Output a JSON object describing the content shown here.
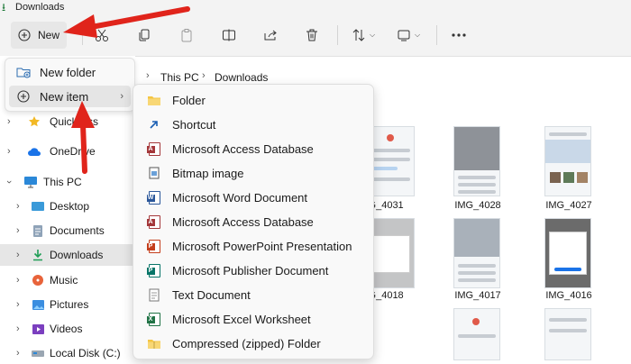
{
  "window": {
    "title": "Downloads"
  },
  "toolbar": {
    "new_label": "New",
    "icons": [
      "plus-circle-icon",
      "cut-icon",
      "copy-icon",
      "paste-icon",
      "rename-icon",
      "share-icon",
      "delete-icon",
      "sort-icon",
      "view-icon",
      "more-icon"
    ]
  },
  "address": {
    "segments": [
      "This PC",
      "Downloads"
    ]
  },
  "flyout": {
    "items": [
      {
        "label": "New folder",
        "icon": "new-folder-icon"
      },
      {
        "label": "New item",
        "icon": "plus-circle-icon",
        "has_submenu": true
      }
    ]
  },
  "submenu": {
    "items": [
      {
        "label": "Folder",
        "icon": "folder-icon"
      },
      {
        "label": "Shortcut",
        "icon": "shortcut-icon"
      },
      {
        "label": "Microsoft Access Database",
        "icon": "access-icon"
      },
      {
        "label": "Bitmap image",
        "icon": "bitmap-icon"
      },
      {
        "label": "Microsoft Word Document",
        "icon": "word-icon"
      },
      {
        "label": "Microsoft Access Database",
        "icon": "access-icon"
      },
      {
        "label": "Microsoft PowerPoint Presentation",
        "icon": "powerpoint-icon"
      },
      {
        "label": "Microsoft Publisher Document",
        "icon": "publisher-icon"
      },
      {
        "label": "Text Document",
        "icon": "text-icon"
      },
      {
        "label": "Microsoft Excel Worksheet",
        "icon": "excel-icon"
      },
      {
        "label": "Compressed (zipped) Folder",
        "icon": "zip-folder-icon"
      }
    ]
  },
  "nav": {
    "items": [
      {
        "label": "Quick access",
        "icon": "star-icon",
        "visible_label": "Quick",
        "tail": "ss"
      },
      {
        "label": "OneDrive",
        "icon": "cloud-icon"
      },
      {
        "label": "This PC",
        "icon": "monitor-icon",
        "expanded": true
      },
      {
        "label": "Desktop",
        "icon": "desktop-icon"
      },
      {
        "label": "Documents",
        "icon": "documents-icon"
      },
      {
        "label": "Downloads",
        "icon": "download-icon",
        "selected": true
      },
      {
        "label": "Music",
        "icon": "music-icon"
      },
      {
        "label": "Pictures",
        "icon": "pictures-icon"
      },
      {
        "label": "Videos",
        "icon": "videos-icon"
      },
      {
        "label": "Local Disk (C:)",
        "icon": "disk-icon"
      }
    ]
  },
  "files": {
    "row1": [
      "IMG_4031",
      "IMG_4028",
      "IMG_4027"
    ],
    "row2": [
      "IMG_4018",
      "IMG_4017",
      "IMG_4016"
    ]
  },
  "colors": {
    "annotation_red": "#e0241b",
    "selected_bg": "#e6e6e6",
    "accent_green": "#1f7a3a"
  }
}
